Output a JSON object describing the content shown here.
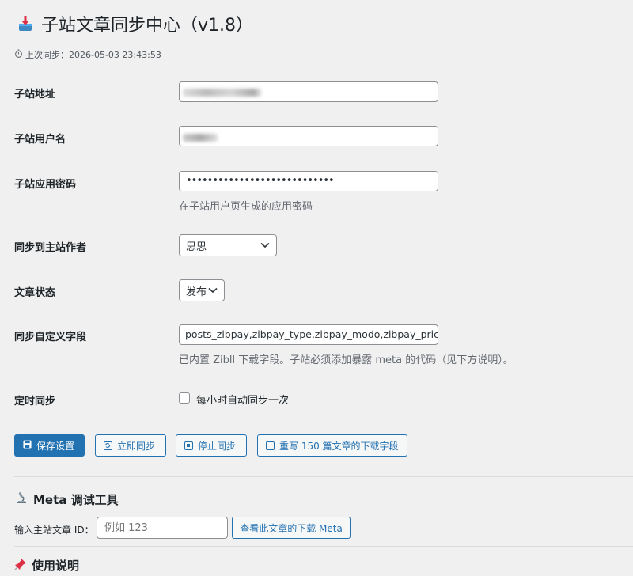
{
  "header": {
    "title": "子站文章同步中心（v1.8）",
    "title_icon": "inbox-tray-icon",
    "last_sync": "上次同步：2026-05-03 23:43:53",
    "last_sync_icon": "stopwatch-icon"
  },
  "form": {
    "site_url": {
      "label": "子站地址",
      "value": ""
    },
    "username": {
      "label": "子站用户名",
      "value": ""
    },
    "app_password": {
      "label": "子站应用密码",
      "value": "••••••••••••••••••••••••••••",
      "description": "在子站用户页生成的应用密码"
    },
    "author": {
      "label": "同步到主站作者",
      "selected": "思思"
    },
    "post_status": {
      "label": "文章状态",
      "selected": "发布"
    },
    "custom_fields": {
      "label": "同步自定义字段",
      "value": "posts_zibpay,zibpay_type,zibpay_modo,zibpay_price,zi",
      "description": "已内置 Zibll 下载字段。子站必须添加暴露 meta 的代码（见下方说明）。"
    },
    "cron": {
      "label": "定时同步",
      "checkbox_label": "每小时自动同步一次",
      "checked": false
    }
  },
  "buttons": {
    "save": "保存设置",
    "sync_now": "立即同步",
    "stop_sync": "停止同步",
    "rewrite": "重写 150 篇文章的下载字段"
  },
  "meta_debug": {
    "title": "Meta 调试工具",
    "icon": "microscope-icon",
    "input_label": "输入主站文章 ID：",
    "input_placeholder": "例如 123",
    "button": "查看此文章的下载 Meta"
  },
  "usage": {
    "title": "使用说明",
    "icon": "pushpin-icon"
  },
  "colors": {
    "primary": "#2271b1",
    "background": "#f0f0f1",
    "text": "#1d2327",
    "muted": "#646970"
  }
}
